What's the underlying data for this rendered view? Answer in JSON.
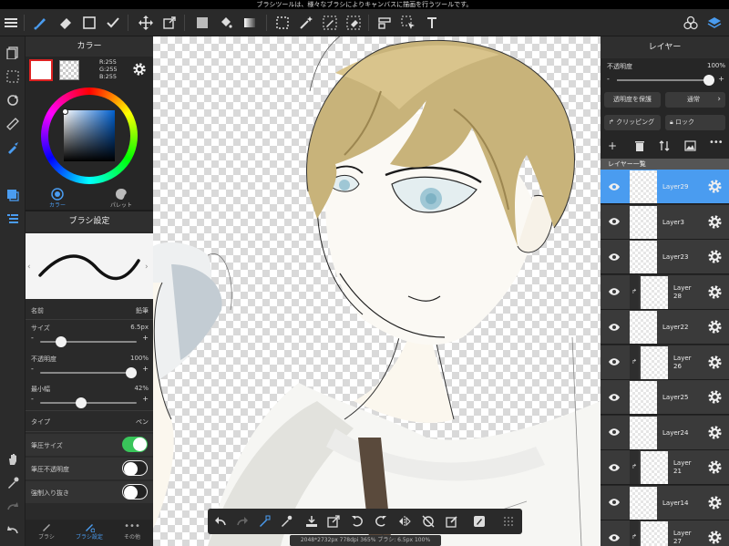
{
  "notice": "ブラシツールは、様々なブラシによりキャンバスに描画を行うツールです。",
  "icons": [
    "menu-icon",
    "brush-icon",
    "eraser-icon",
    "rect-icon",
    "fill-pen-icon",
    "move-icon",
    "transform-icon",
    "fill-color-icon",
    "bucket-icon",
    "gradient-icon",
    "select-rect-icon",
    "magic-wand-icon",
    "select-pen-icon",
    "select-eraser-icon",
    "layer-select-icon",
    "move-select-icon",
    "text-icon",
    "materials-icon",
    "layers-icon"
  ],
  "color_panel": {
    "title": "カラー",
    "rgb": [
      "R:255",
      "G:255",
      "B:255"
    ],
    "tab_color": "カラー",
    "tab_palette": "パレット",
    "hue_gradient": "conic-gradient(#ff0000,#ffff00,#00ff00,#00ffff,#0000ff,#ff00ff,#ff0000)",
    "square_colors": [
      "#ffffff",
      "#0060d0",
      "#000000"
    ]
  },
  "brush_panel": {
    "title": "ブラシ設定",
    "name_label": "名前",
    "name_value": "鉛筆",
    "size_label": "サイズ",
    "size_value": "6.5px",
    "size_level": 0.18,
    "opacity_label": "不透明度",
    "opacity_value": "100%",
    "opacity_level": 1.0,
    "minwidth_label": "最小幅",
    "minwidth_value": "42%",
    "minwidth_level": 0.42,
    "type_label": "タイプ",
    "type_value": "ペン",
    "pressure_size_label": "筆圧サイズ",
    "pressure_size_on": true,
    "pressure_opacity_label": "筆圧不透明度",
    "pressure_opacity_on": false,
    "taper_label": "強制入り抜き",
    "taper_on": false,
    "bottom_tabs": [
      "ブラシ",
      "ブラシ設定",
      "その他"
    ],
    "active_tab": 1,
    "accent": "#4a9cf0",
    "toggle_on_color": "#39c55a"
  },
  "layer_panel": {
    "title": "レイヤー",
    "opacity_label": "不透明度",
    "opacity_value": "100%",
    "protect_label": "透明度を保護",
    "blend_label": "通常",
    "clipping_label": "クリッピング",
    "lock_label": "ロック",
    "list_title": "レイヤー一覧",
    "layers": [
      {
        "name": "Layer29",
        "selected": true,
        "clip": false
      },
      {
        "name": "Layer3",
        "selected": false,
        "clip": false
      },
      {
        "name": "Layer23",
        "selected": false,
        "clip": false
      },
      {
        "name": "Layer\n28",
        "selected": false,
        "clip": true
      },
      {
        "name": "Layer22",
        "selected": false,
        "clip": false
      },
      {
        "name": "Layer\n26",
        "selected": false,
        "clip": true
      },
      {
        "name": "Layer25",
        "selected": false,
        "clip": false
      },
      {
        "name": "Layer24",
        "selected": false,
        "clip": false
      },
      {
        "name": "Layer\n21",
        "selected": false,
        "clip": true
      },
      {
        "name": "Layer14",
        "selected": false,
        "clip": false
      },
      {
        "name": "Layer\n27",
        "selected": false,
        "clip": true
      }
    ],
    "selected_color": "#4a9cf0"
  },
  "status": "2048*2732px 778dpi 365% ブラシ: 6.5px 100%"
}
